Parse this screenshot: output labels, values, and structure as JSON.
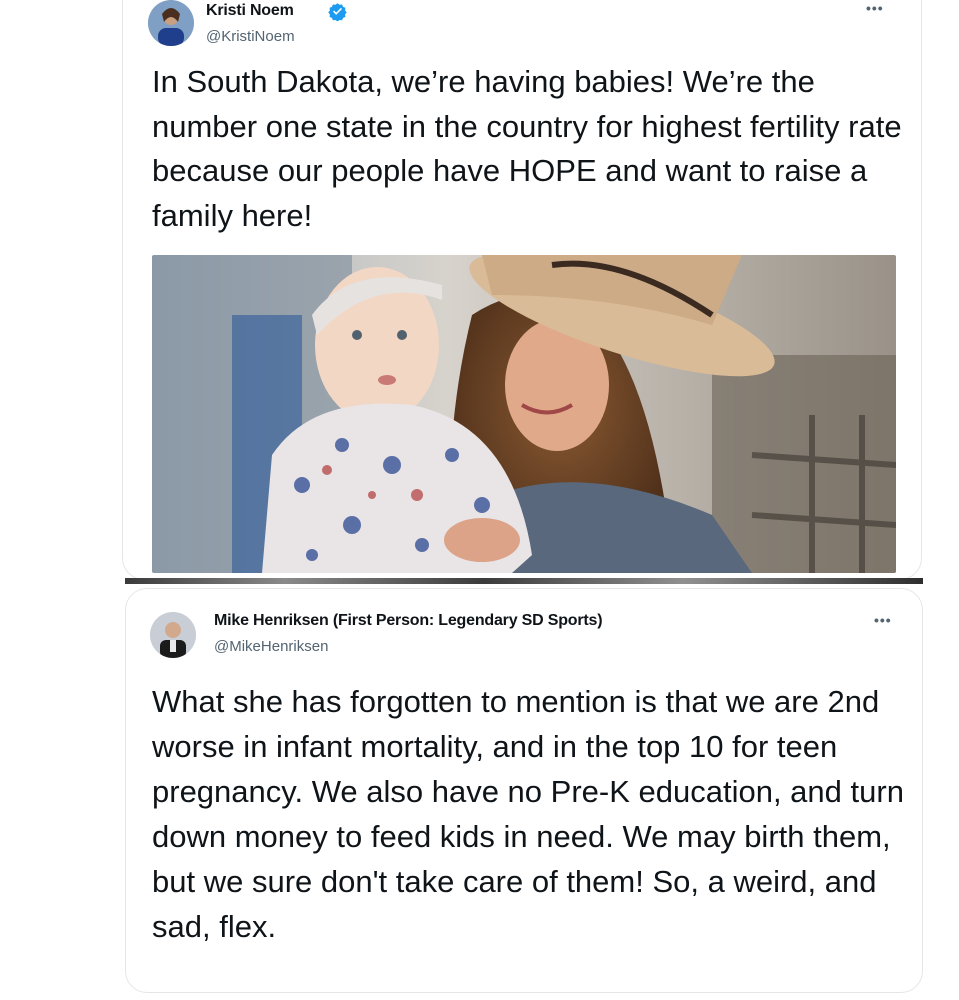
{
  "tweet1": {
    "author_name": "Kristi Noem",
    "handle": "@KristiNoem",
    "verified": true,
    "more_icon": "ellipsis-icon",
    "text": "In South Dakota, we’re having babies! We’re the number one state in the country for highest fertility rate because our people have HOPE and want to raise a family here!",
    "image_alt": "Woman in cowboy hat holding a baby in floral outfit"
  },
  "tweet2": {
    "author_name": "Mike Henriksen (First Person: Legendary SD Sports)",
    "handle": "@MikeHenriksen",
    "more_icon": "ellipsis-icon",
    "text": "What she has forgotten to mention is that we are 2nd worse in infant mortality, and in the top 10 for teen pregnancy. We also have no Pre-K education, and turn down money to feed kids in need. We may birth them, but we sure don't take care of them! So, a weird, and sad, flex."
  },
  "colors": {
    "verified_blue": "#1d9bf0",
    "secondary_text": "#536471",
    "primary_text": "#0f1419"
  }
}
